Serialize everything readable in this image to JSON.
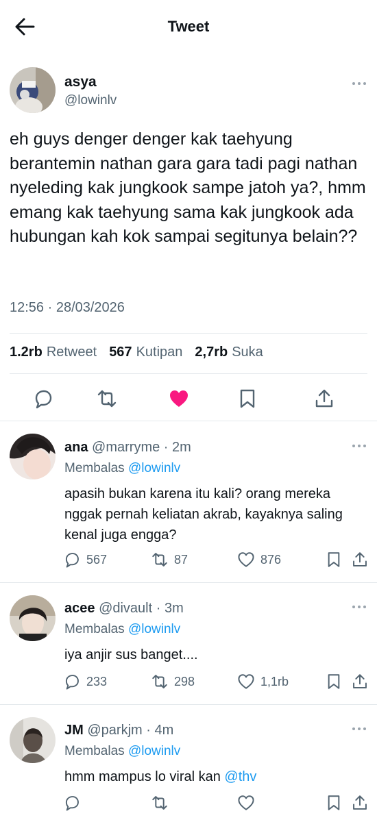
{
  "header": {
    "title": "Tweet",
    "back_icon": "arrow-left-icon"
  },
  "main_tweet": {
    "name": "asya",
    "handle": "@lowinlv",
    "text": "eh guys denger denger kak taehyung berantemin nathan gara gara tadi pagi nathan nyeleding kak jungkook sampe jatoh ya?, hmm emang kak taehyung sama kak jungkook ada hubungan kah kok sampai segitunya belain??",
    "timestamp": "12:56 · 28/03/2026",
    "stats": [
      {
        "value": "1.2rb",
        "label": "Retweet"
      },
      {
        "value": "567",
        "label": "Kutipan"
      },
      {
        "value": "2,7rb",
        "label": "Suka"
      }
    ],
    "liked": true,
    "like_color": "#f91880"
  },
  "replies": [
    {
      "name": "ana",
      "meta": "@marryme · 2m",
      "replying_prefix": "Membalas",
      "replying_to": "@lowinlv",
      "text": "apasih bukan karena itu kali? orang mereka nggak pernah keliatan akrab, kayaknya saling kenal juga engga?",
      "replies": "567",
      "retweets": "87",
      "likes": "876"
    },
    {
      "name": "acee",
      "meta": "@divault · 3m",
      "replying_prefix": "Membalas",
      "replying_to": "@lowinlv",
      "text": "iya anjir sus banget....",
      "replies": "233",
      "retweets": "298",
      "likes": "1,1rb"
    },
    {
      "name": "JM",
      "meta": "@parkjm · 4m",
      "replying_prefix": "Membalas",
      "replying_to": "@lowinlv",
      "text": "hmm mampus lo viral kan",
      "mention": "@thv",
      "replies": "",
      "retweets": "",
      "likes": ""
    }
  ],
  "colors": {
    "accent": "#1d9bf0",
    "muted": "#536471",
    "text": "#0f1419"
  }
}
